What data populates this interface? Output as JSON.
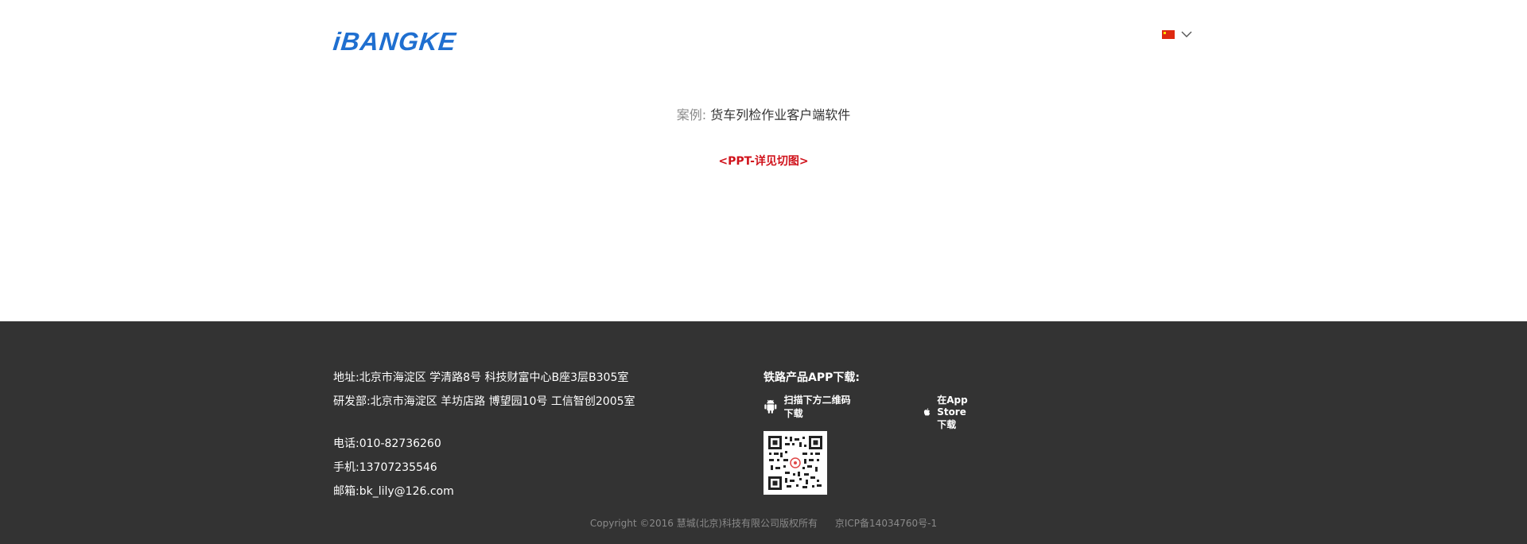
{
  "header": {
    "logo_text": "iBANGKE",
    "language_flag": "china-flag-icon"
  },
  "main": {
    "case_label": "案例:",
    "case_title": "货车列检作业客户端软件",
    "ppt_note": "<PPT-详见切图>"
  },
  "footer": {
    "address": "地址:北京市海淀区 学清路8号 科技财富中心B座3层B305室",
    "rd_address": "研发部:北京市海淀区 羊坊店路 博望园10号 工信智创2005室",
    "phone": "电话:010-82736260",
    "mobile": "手机:13707235546",
    "email": "邮箱:bk_lily@126.com",
    "download_title": "铁路产品APP下载:",
    "android_label": "扫描下方二维码下载",
    "ios_label": "在App Store下载",
    "copyright": "Copyright ©2016 慧城(北京)科技有限公司版权所有",
    "icp": "京ICP备14034760号-1"
  },
  "colors": {
    "brand": "#1f6fd0",
    "accent_red": "#d0121b",
    "footer_bg": "#333333"
  }
}
